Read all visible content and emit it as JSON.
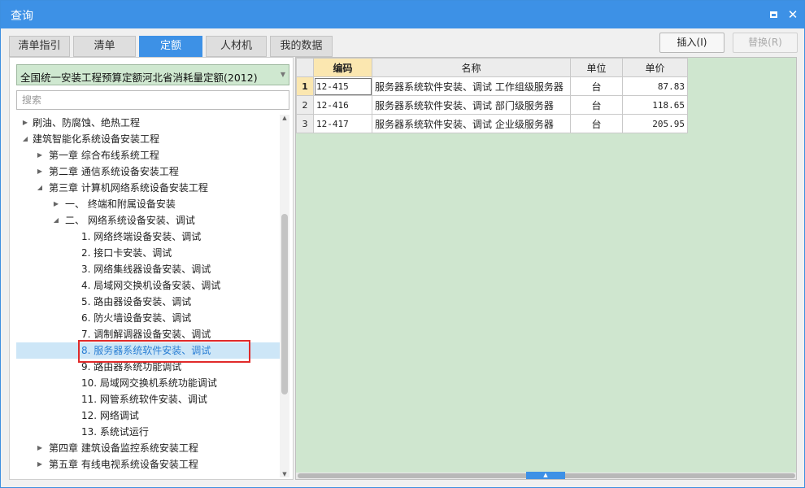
{
  "window": {
    "title": "查询",
    "maximize_icon": "maximize-icon",
    "close_icon": "close-icon",
    "close_glyph": "✕"
  },
  "tabs": [
    {
      "label": "清单指引"
    },
    {
      "label": "清单"
    },
    {
      "label": "定额"
    },
    {
      "label": "人材机"
    },
    {
      "label": "我的数据"
    }
  ],
  "actions": {
    "insert_label": "插入(I)",
    "replace_label": "替换(R)"
  },
  "left": {
    "library_select": "全国统一安装工程预算定额河北省消耗量定额(2012)",
    "search_placeholder": "搜索"
  },
  "tree": [
    {
      "label": "刷油、防腐蚀、绝热工程",
      "expander": "▶"
    },
    {
      "label": "建筑智能化系统设备安装工程",
      "expander": "◢"
    },
    {
      "label": "第一章 综合布线系统工程",
      "expander": "▶"
    },
    {
      "label": "第二章 通信系统设备安装工程",
      "expander": "▶"
    },
    {
      "label": "第三章 计算机网络系统设备安装工程",
      "expander": "◢"
    },
    {
      "label": "一、 终端和附属设备安装",
      "expander": "▶"
    },
    {
      "label": "二、 网络系统设备安装、调试",
      "expander": "◢"
    },
    {
      "label": "1. 网络终端设备安装、调试",
      "expander": ""
    },
    {
      "label": "2. 接口卡安装、调试",
      "expander": ""
    },
    {
      "label": "3. 网络集线器设备安装、调试",
      "expander": ""
    },
    {
      "label": "4. 局域网交换机设备安装、调试",
      "expander": ""
    },
    {
      "label": "5. 路由器设备安装、调试",
      "expander": ""
    },
    {
      "label": "6. 防火墙设备安装、调试",
      "expander": ""
    },
    {
      "label": "7. 调制解调器设备安装、调试",
      "expander": ""
    },
    {
      "label": "8. 服务器系统软件安装、调试",
      "expander": ""
    },
    {
      "label": "9. 路由器系统功能调试",
      "expander": ""
    },
    {
      "label": "10. 局域网交换机系统功能调试",
      "expander": ""
    },
    {
      "label": "11. 网管系统软件安装、调试",
      "expander": ""
    },
    {
      "label": "12. 网络调试",
      "expander": ""
    },
    {
      "label": "13. 系统试运行",
      "expander": ""
    },
    {
      "label": "第四章 建筑设备监控系统安装工程",
      "expander": "▶"
    },
    {
      "label": "第五章 有线电视系统设备安装工程",
      "expander": "▶"
    }
  ],
  "grid": {
    "headers": {
      "code": "编码",
      "name": "名称",
      "unit": "单位",
      "price": "单价"
    },
    "rows": [
      {
        "no": "1",
        "code": "12-415",
        "name": "服务器系统软件安装、调试 工作组级服务器",
        "unit": "台",
        "price": "87.83"
      },
      {
        "no": "2",
        "code": "12-416",
        "name": "服务器系统软件安装、调试 部门级服务器",
        "unit": "台",
        "price": "118.65"
      },
      {
        "no": "3",
        "code": "12-417",
        "name": "服务器系统软件安装、调试 企业级服务器",
        "unit": "台",
        "price": "205.95"
      }
    ]
  },
  "colors": {
    "accent": "#3d91e6",
    "grid_bg": "#cfe6cf",
    "selection_box": "#e02a2a",
    "selected_row": "#cde6f7"
  }
}
